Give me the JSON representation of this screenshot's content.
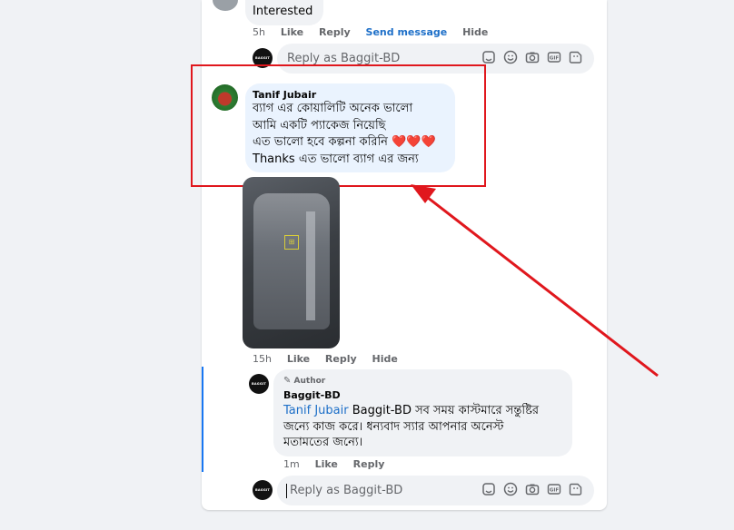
{
  "top_comment": {
    "text": "Interested",
    "time": "5h",
    "actions": [
      "Like",
      "Reply",
      "Send message",
      "Hide"
    ]
  },
  "reply_box_1": {
    "placeholder": "Reply as Baggit-BD"
  },
  "main_comment": {
    "author": "Tanif Jubair",
    "lines": [
      "ব্যাগ এর কোয়ালিটি অনেক ভালো",
      "আমি একটি প্যাকেজ নিয়েছি",
      "এত ভালো হবে কল্পনা করিনি ❤️❤️❤️",
      "Thanks এত ভালো ব্যাগ এর জন্য"
    ],
    "time": "15h",
    "actions": [
      "Like",
      "Reply",
      "Hide"
    ]
  },
  "page_reply": {
    "badge": "Author",
    "author": "Baggit-BD",
    "mention": "Tanif Jubair",
    "line1_rest": " Baggit-BD সব সময় কাস্টমারে সন্তুষ্টির",
    "line2": "জন্যে কাজ করে। ধন্যবাদ স্যার আপনার অনেস্ট",
    "line3": "মতামতের জন্যে।",
    "time": "1m",
    "actions": [
      "Like",
      "Reply"
    ]
  },
  "reply_box_2": {
    "placeholder": "Reply as Baggit-BD"
  },
  "brand": {
    "logo_text": "BAGGIT"
  },
  "icons": [
    "sticker-icon",
    "emoji-icon",
    "camera-icon",
    "gif-icon",
    "stickers-icon"
  ],
  "colors": {
    "link": "#1d6fc8",
    "annotation": "#e0171d",
    "bubble_highlight": "#eaf3fe"
  }
}
